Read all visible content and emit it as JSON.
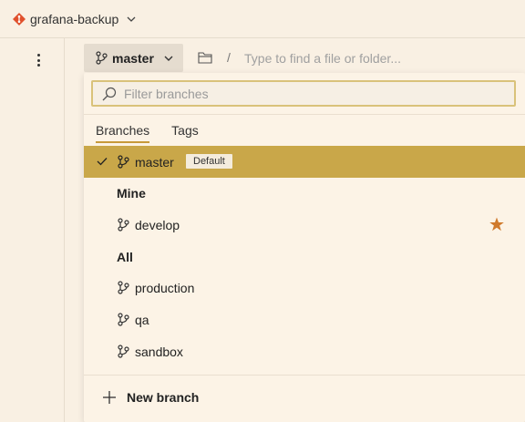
{
  "repo": {
    "name": "grafana-backup",
    "icon": "git-repo-icon"
  },
  "branch_picker": {
    "current": "master"
  },
  "path": {
    "placeholder": "Type to find a file or folder..."
  },
  "dropdown": {
    "filter_placeholder": "Filter branches",
    "tabs": [
      "Branches",
      "Tags"
    ],
    "active_tab": "Branches",
    "selected": {
      "name": "master",
      "badge": "Default"
    },
    "sections": [
      {
        "title": "Mine",
        "branches": [
          {
            "name": "develop",
            "favorite": true
          }
        ]
      },
      {
        "title": "All",
        "branches": [
          {
            "name": "production"
          },
          {
            "name": "qa"
          },
          {
            "name": "sandbox"
          }
        ]
      }
    ],
    "new_branch_label": "New branch"
  },
  "colors": {
    "background": "#f9f0e3",
    "selected_row": "#c9a749",
    "star": "#d07a2c",
    "repo_icon": "#e0502c"
  }
}
